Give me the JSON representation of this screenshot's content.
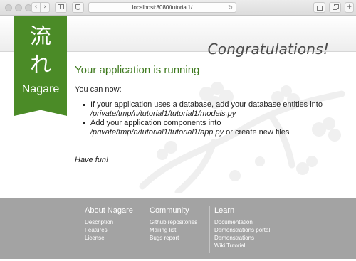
{
  "browser": {
    "url": "localhost:8080/tutorial1/",
    "back_glyph": "‹",
    "forward_glyph": "›",
    "plus_glyph": "+",
    "reload_glyph": "↻",
    "icons": [
      "back-icon",
      "forward-icon",
      "sidebar-icon",
      "shield-icon",
      "reload-icon",
      "share-icon",
      "tabs-icon",
      "new-tab-icon"
    ]
  },
  "logo": {
    "kanji_top": "流",
    "kanji_bottom": "れ",
    "word": "Nagare",
    "color": "#4b8b27"
  },
  "header": {
    "title": "Congratulations!"
  },
  "main": {
    "heading": "Your application is running",
    "intro": "You can now:",
    "steps": [
      {
        "text": "If your application uses a database, add your database entities into",
        "path": "/private/tmp/n/tutorial1/tutorial1/models.py",
        "suffix": ""
      },
      {
        "text": "Add your application components into",
        "path": "/private/tmp/n/tutorial1/tutorial1/app.py",
        "suffix": " or create new files"
      }
    ],
    "outro": "Have fun!"
  },
  "footer": {
    "columns": [
      {
        "title": "About Nagare",
        "links": [
          "Description",
          "Features",
          "License"
        ]
      },
      {
        "title": "Community",
        "links": [
          "Github repositories",
          "Mailing list",
          "Bugs report"
        ]
      },
      {
        "title": "Learn",
        "links": [
          "Documentation",
          "Demonstrations portal",
          "Demonstrations",
          "Wiki Tutorial"
        ]
      }
    ],
    "background": "#a3a3a3"
  }
}
